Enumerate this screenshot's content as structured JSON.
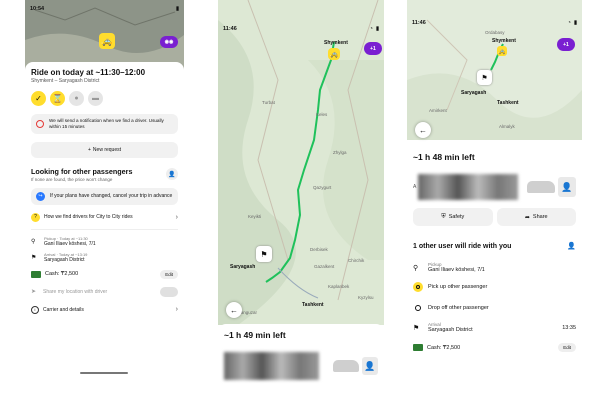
{
  "colors": {
    "accent": "#ffdd2d",
    "route": "#1fc15b",
    "brand": "#7a1fd1",
    "grey_bg": "#f1f1f1"
  },
  "phone1": {
    "status": {
      "time": "10:54"
    },
    "title": "Ride on today at ~11:30–12:00",
    "subtitle": "Shymkent – Saryagash District",
    "notice": "We will send a notification when we find a driver. Usually within 15 minutes",
    "new_request": "New request",
    "passengers": {
      "title": "Looking for other passengers",
      "subtitle": "If none are found, the price won't change"
    },
    "plans_changed": "If your plans have changed, cancel your trip in advance",
    "how_we_find": "How we find drivers for City to City rides",
    "pickup": {
      "label": "Pickup · Today at ~11:30",
      "value": "Gani Iliaev köshesi, 7/1"
    },
    "arrival": {
      "label": "Arrival · Today at ~13:19",
      "value": "Saryagash District"
    },
    "payment": {
      "label": "Cash: ₸2,500",
      "edit": "Edit"
    },
    "share_location": "Share my location with driver",
    "carrier": "Carrier and details"
  },
  "phone2": {
    "status": {
      "time": "11:46"
    },
    "badge": "+1",
    "map_labels": {
      "shymkent": "Shymkent",
      "saryagash": "Saryagash",
      "tashkent": "Tashkent",
      "kaplanbek": "Kaplanbek",
      "kazygurt": "Qazygurt",
      "derbisek": "Derbisek",
      "chirchik": "Chirchik",
      "keles": "Keles",
      "eshanguzar": "Eshanguzar",
      "keyikti": "Keyikti",
      "turbat": "Turbat",
      "kyzylsu": "Kyzylsu",
      "zhylga": "Zhylga",
      "gazalkent": "Gazalkent"
    },
    "time_left": "~1 h 49 min left"
  },
  "phone3": {
    "status": {
      "time": "11:46"
    },
    "badge": "+1",
    "map_labels": {
      "shymkent": "Shymkent",
      "saryagash": "Saryagash",
      "tashkent": "Tashkent",
      "ordabasy": "Ordabasy",
      "amirkent": "Amirkent",
      "almalyk": "Almalyk"
    },
    "time_left": "~1 h 48 min left",
    "plate_partial": "A",
    "safety": "Safety",
    "share": "Share",
    "other_user": "1 other user will ride with you",
    "pickup": {
      "label": "Pickup",
      "value": "Gani Iliaev köshesi, 7/1"
    },
    "pick_up_other": "Pick up other passenger",
    "drop_off_other": "Drop off other passenger",
    "arrival": {
      "label": "Arrival",
      "value": "Saryagash District",
      "time": "13:35"
    },
    "payment": {
      "label": "Cash: ₸2,500",
      "edit": "Edit"
    }
  }
}
